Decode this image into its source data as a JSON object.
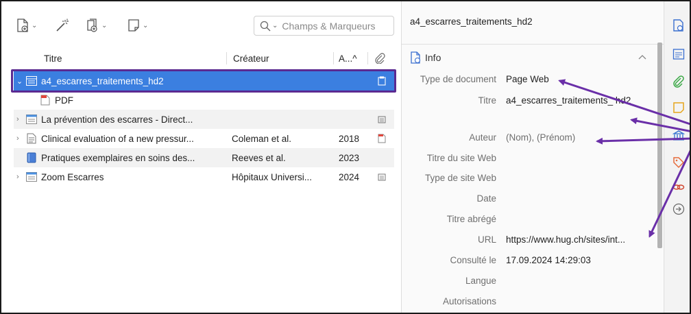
{
  "toolbar": {
    "search_placeholder": "Champs & Marqueurs"
  },
  "columns": {
    "title": "Titre",
    "creator": "Créateur",
    "year": "A...^"
  },
  "items": [
    {
      "title": "a4_escarres_traitements_hd2",
      "creator": "",
      "year": "",
      "twisty": "⌄",
      "type": "webpage",
      "attachment": "webpage-snapshot",
      "selected": true
    },
    {
      "title": "PDF",
      "creator": "",
      "year": "",
      "twisty": "",
      "type": "pdf",
      "attachment": "",
      "child": true
    },
    {
      "title": "La prévention des escarres - Direct...",
      "creator": "",
      "year": "",
      "twisty": "›",
      "type": "webpage",
      "attachment": "snapshot"
    },
    {
      "title": "Clinical evaluation of a new pressur...",
      "creator": "Coleman et al.",
      "year": "2018",
      "twisty": "›",
      "type": "document",
      "attachment": "pdf"
    },
    {
      "title": "Pratiques exemplaires en soins des...",
      "creator": "Reeves et al.",
      "year": "2023",
      "twisty": "",
      "type": "book",
      "attachment": ""
    },
    {
      "title": "Zoom Escarres",
      "creator": "Hôpitaux Universi...",
      "year": "2024",
      "twisty": "›",
      "type": "webpage",
      "attachment": "snapshot"
    }
  ],
  "detail": {
    "item_title": "a4_escarres_traitements_hd2",
    "section": "Info",
    "fields": [
      {
        "label": "Type de document",
        "value": "Page Web"
      },
      {
        "label": "Titre",
        "value": "a4_escarres_traitements_ hd2"
      },
      {
        "label": "Auteur",
        "value": "(Nom), (Prénom)"
      },
      {
        "label": "Titre du site Web",
        "value": ""
      },
      {
        "label": "Type de site Web",
        "value": ""
      },
      {
        "label": "Date",
        "value": ""
      },
      {
        "label": "Titre abrégé",
        "value": ""
      },
      {
        "label": "URL",
        "value": "https://www.hug.ch/sites/int..."
      },
      {
        "label": "Consulté le",
        "value": "17.09.2024 14:29:03"
      },
      {
        "label": "Langue",
        "value": ""
      },
      {
        "label": "Autorisations",
        "value": ""
      }
    ]
  },
  "colors": {
    "selection": "#3b7fe0",
    "annotation": "#6a2fa8",
    "row_alt": "#f2f2f2"
  }
}
